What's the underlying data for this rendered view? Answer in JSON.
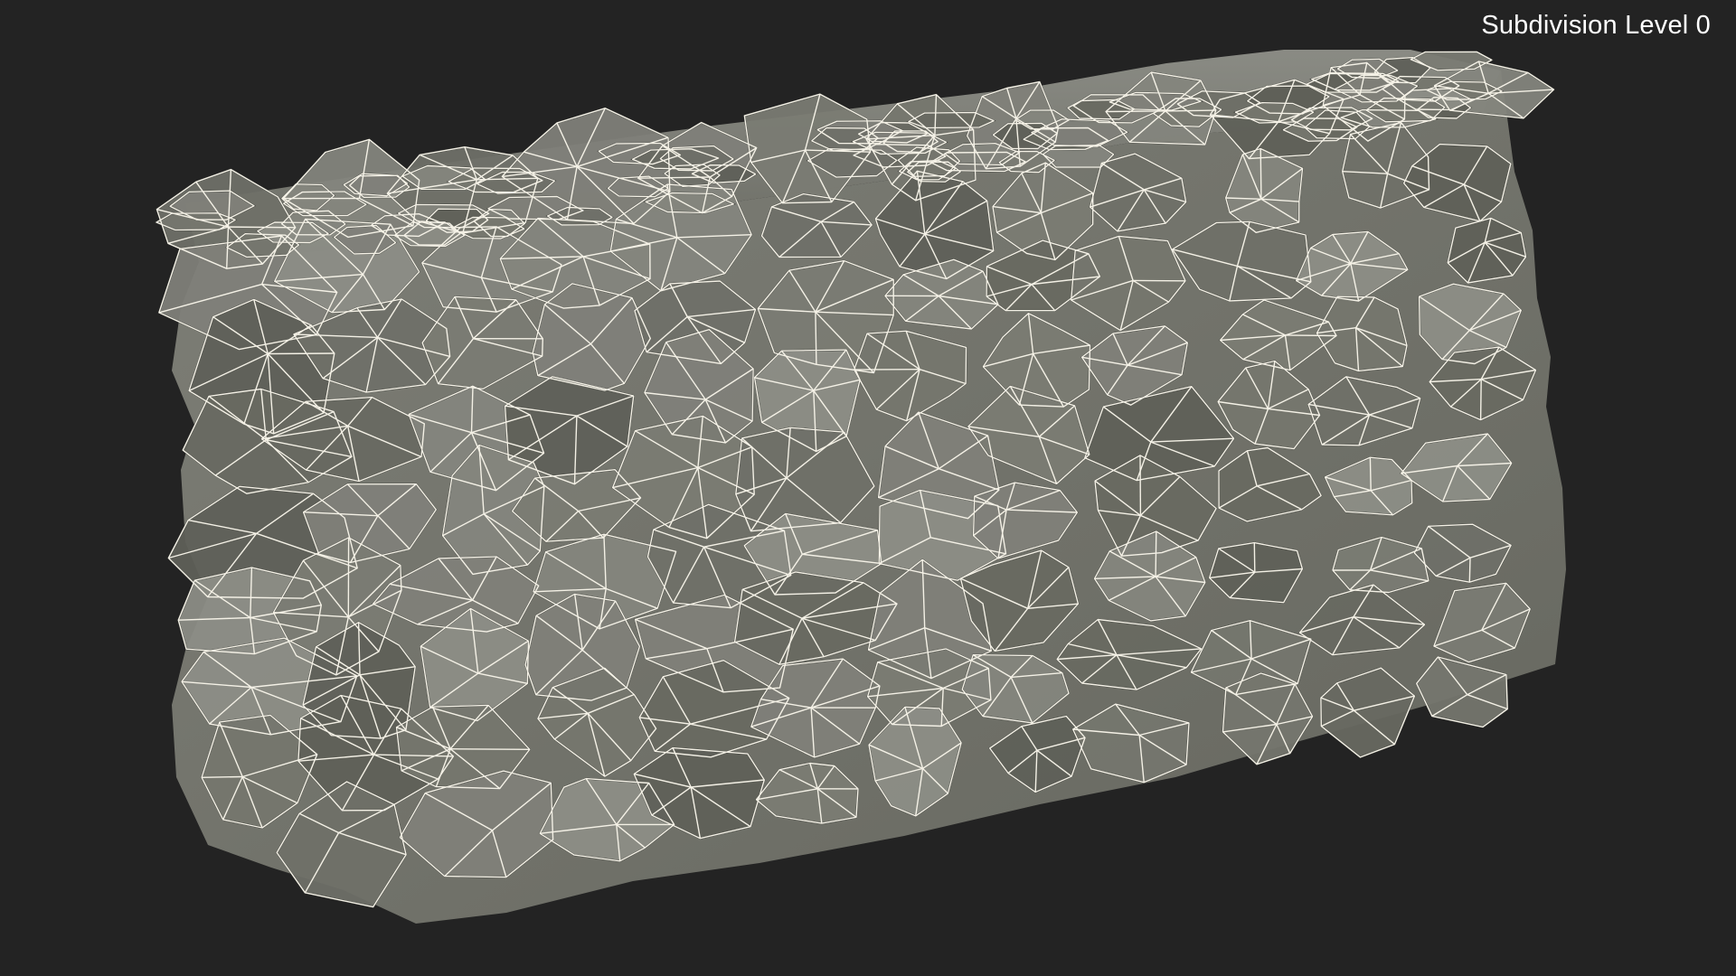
{
  "viewport": {
    "background": "#232323",
    "overlay_label": "Subdivision Level 0"
  },
  "model": {
    "description_icon": "stone-gabion-wall-mesh",
    "face_color": "#75766d",
    "face_color_light": "#888880",
    "face_color_dark": "#4e4f49",
    "wire_color": "#f4f1e6"
  }
}
